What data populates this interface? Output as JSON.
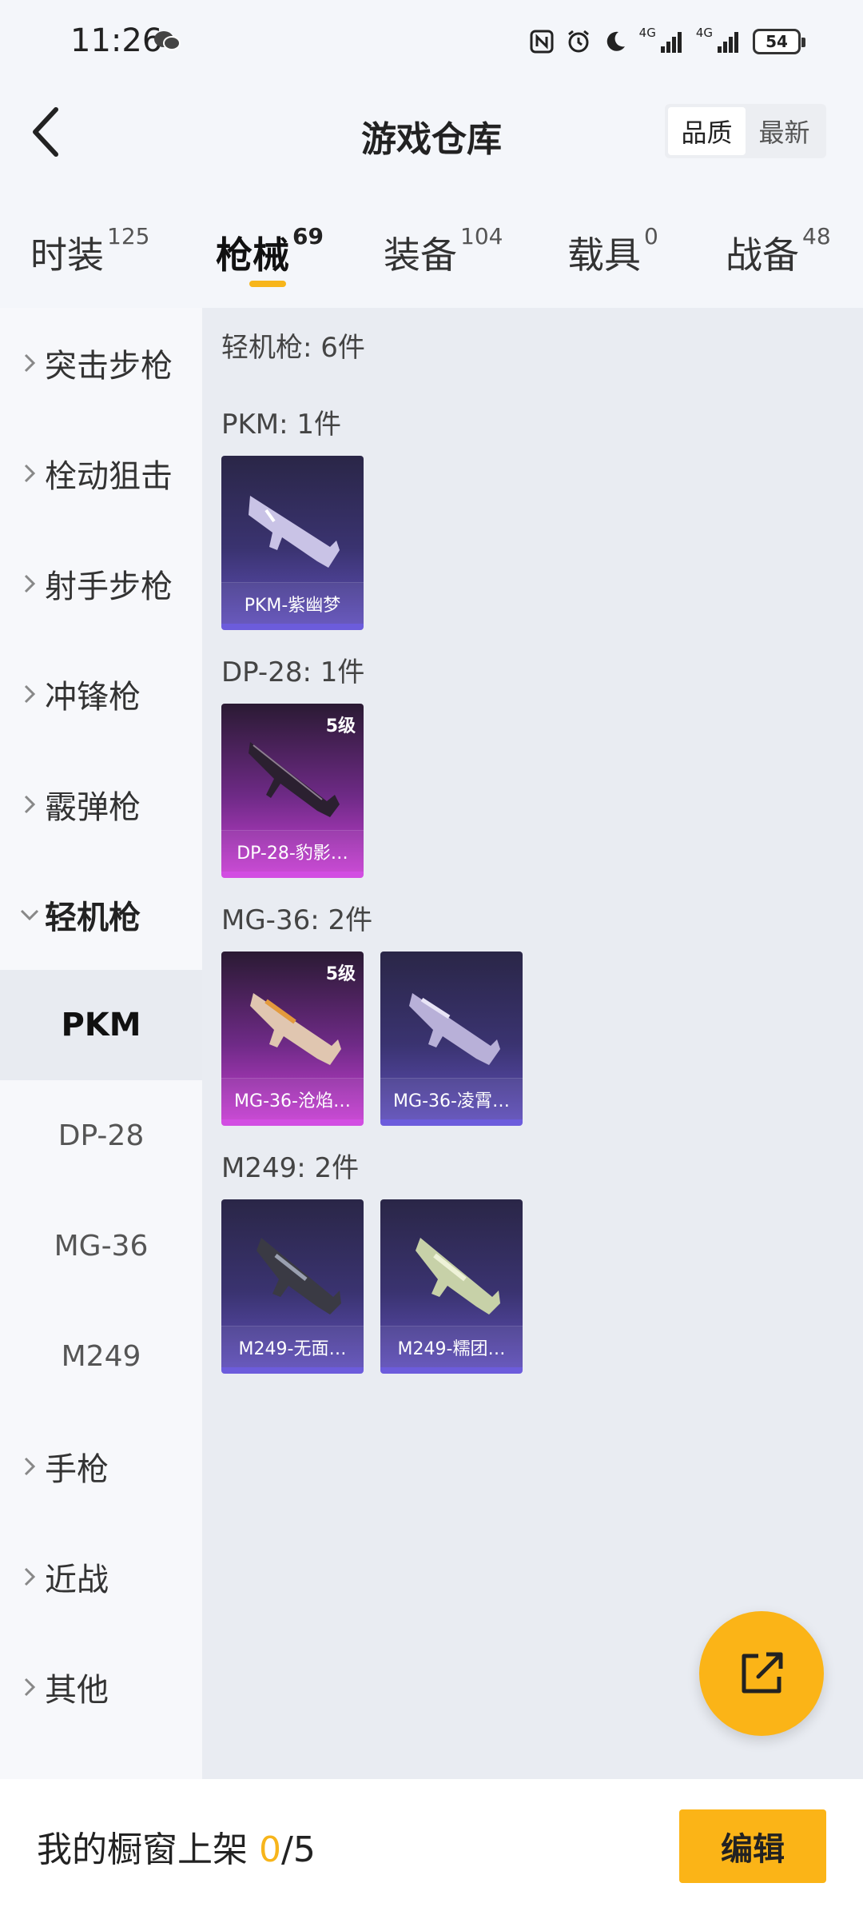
{
  "status_bar": {
    "time": "11:26",
    "signal1_label": "4G",
    "signal2_label": "4G",
    "battery": "54",
    "icons": [
      "wechat-icon",
      "nfc-icon",
      "alarm-icon",
      "moon-icon",
      "signal-icon",
      "signal-icon",
      "battery-icon"
    ]
  },
  "header": {
    "title": "游戏仓库",
    "sort_options": [
      "品质",
      "最新"
    ],
    "active_sort": "品质"
  },
  "tabs": [
    {
      "label": "时装",
      "count": "125"
    },
    {
      "label": "枪械",
      "count": "69",
      "active": true
    },
    {
      "label": "装备",
      "count": "104"
    },
    {
      "label": "载具",
      "count": "0"
    },
    {
      "label": "战备",
      "count": "48"
    }
  ],
  "sidebar": {
    "categories": [
      "突击步枪",
      "栓动狙击",
      "射手步枪",
      "冲锋枪",
      "霰弹枪",
      "轻机枪",
      "手枪",
      "近战",
      "其他"
    ],
    "expanded": "轻机枪",
    "subitems": [
      "PKM",
      "DP-28",
      "MG-36",
      "M249"
    ],
    "active_sub": "PKM"
  },
  "content": {
    "header": "轻机枪: 6件",
    "groups": [
      {
        "title": "PKM: 1件",
        "items": [
          {
            "name": "PKM-紫幽梦",
            "rarity": "purple",
            "level": ""
          }
        ]
      },
      {
        "title": "DP-28: 1件",
        "items": [
          {
            "name": "DP-28-豹影…",
            "rarity": "pink",
            "level": "5级"
          }
        ]
      },
      {
        "title": "MG-36: 2件",
        "items": [
          {
            "name": "MG-36-沧焰…",
            "rarity": "pink",
            "level": "5级"
          },
          {
            "name": "MG-36-凌霄…",
            "rarity": "purple",
            "level": ""
          }
        ]
      },
      {
        "title": "M249: 2件",
        "items": [
          {
            "name": "M249-无面…",
            "rarity": "purple",
            "level": ""
          },
          {
            "name": "M249-糯团…",
            "rarity": "purple",
            "level": ""
          }
        ]
      }
    ]
  },
  "bottom_bar": {
    "label": "我的橱窗上架 ",
    "current": "0",
    "total": "/5",
    "edit_label": "编辑"
  },
  "colors": {
    "accent": "#fbb417",
    "purple_rarity": "#6c5cdc",
    "pink_rarity": "#d24ee2"
  }
}
